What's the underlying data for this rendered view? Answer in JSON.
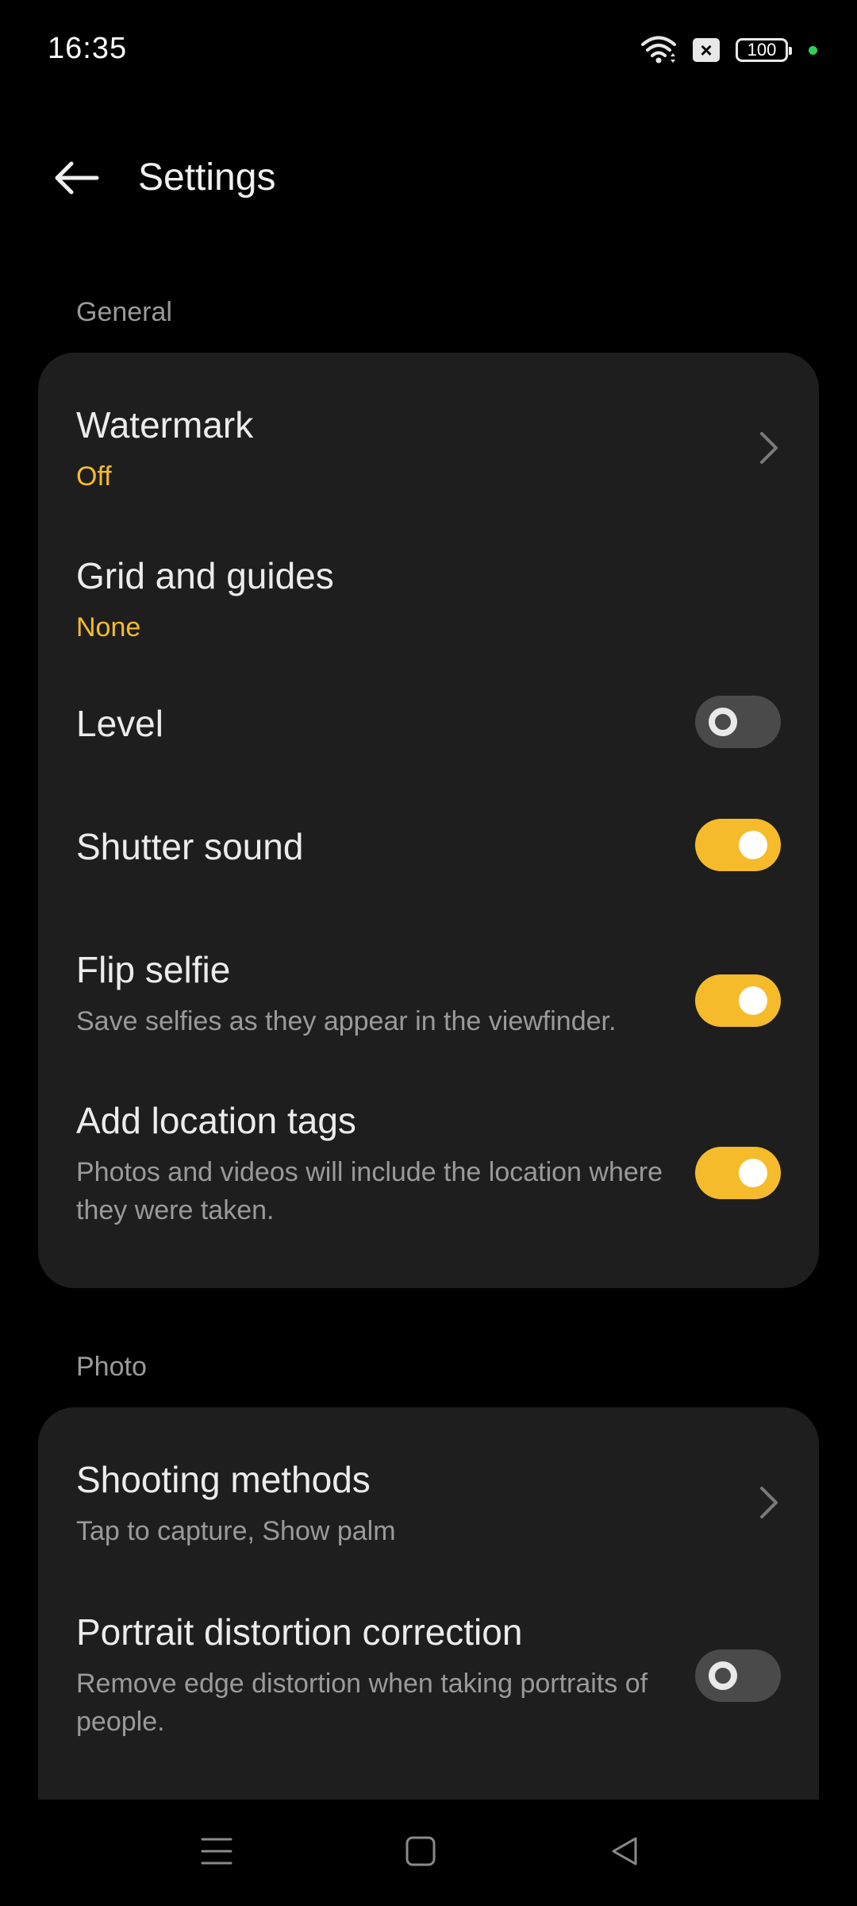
{
  "status_bar": {
    "time": "16:35",
    "sim_symbol": "×",
    "battery_level": "100",
    "icons": [
      "wifi-icon",
      "sim-disabled-icon",
      "battery-icon",
      "privacy-indicator-dot"
    ]
  },
  "header": {
    "title": "Settings",
    "back_icon": "arrow-left-icon"
  },
  "sections": {
    "general": {
      "label": "General",
      "watermark": {
        "title": "Watermark",
        "value": "Off"
      },
      "grid": {
        "title": "Grid and guides",
        "value": "None"
      },
      "level": {
        "title": "Level",
        "enabled": false
      },
      "shutter_sound": {
        "title": "Shutter sound",
        "enabled": true
      },
      "flip_selfie": {
        "title": "Flip selfie",
        "description": "Save selfies as they appear in the viewfinder.",
        "enabled": true
      },
      "location_tags": {
        "title": "Add location tags",
        "description": "Photos and videos will include the location where they were taken.",
        "enabled": true
      }
    },
    "photo": {
      "label": "Photo",
      "shooting_methods": {
        "title": "Shooting methods",
        "description": "Tap to capture, Show palm"
      },
      "portrait_distortion": {
        "title": "Portrait distortion correction",
        "description": "Remove edge distortion when taking portraits of people.",
        "enabled": false
      }
    }
  },
  "colors": {
    "accent": "#f6bb2b",
    "background": "#000000",
    "card": "#1e1e1e",
    "secondary_text": "#9a9a9a",
    "toggle_off": "#4a4a4a"
  },
  "nav_bar": {
    "icons": [
      "menu-icon",
      "home-icon",
      "back-triangle-icon"
    ]
  }
}
